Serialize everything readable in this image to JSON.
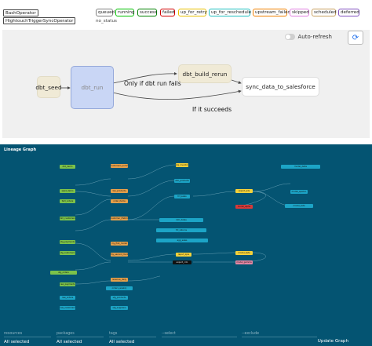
{
  "operators": [
    "BashOperator",
    "HightouchTriggerSyncOperator"
  ],
  "states": [
    {
      "label": "queued",
      "color": "#808080"
    },
    {
      "label": "running",
      "color": "#00c000"
    },
    {
      "label": "success",
      "color": "#008000"
    },
    {
      "label": "failed",
      "color": "#d00000"
    },
    {
      "label": "up_for_retry",
      "color": "#e8c000"
    },
    {
      "label": "up_for_reschedule",
      "color": "#20c0c0"
    },
    {
      "label": "upstream_failed",
      "color": "#f08000"
    },
    {
      "label": "skipped",
      "color": "#e080e0"
    },
    {
      "label": "scheduled",
      "color": "#c8a060"
    },
    {
      "label": "deferred",
      "color": "#8050c0"
    }
  ],
  "no_status": "no_status",
  "graph": {
    "auto_refresh_label": "Auto-refresh",
    "refresh_icon": "refresh-icon",
    "tasks": {
      "dbt_seed": "dbt_seed",
      "dbt_run": "dbt_run",
      "dbt_build_rerun": "dbt_build_rerun",
      "sync": "sync_data_to_salesforce"
    },
    "edge_labels": {
      "fail": "Only if dbt run fails",
      "succeed": "If it succeeds"
    },
    "colors": {
      "bash_fill": "#f0ead6",
      "sync_fill": "#ffffff",
      "selected_fill": "#c9d6f5"
    }
  },
  "lineage": {
    "title": "Lineage Graph",
    "nodes": {
      "n1": "dbt_demo",
      "n2": "seed_demo",
      "n3": "fact_orders",
      "n4": "dim_customers",
      "n5": "stg_payments",
      "n6": "stg_customers",
      "n7": "stg_orders",
      "n8": "raw_payments",
      "n9": "raw_orders",
      "n10": "raw_customers",
      "n11": "customers_summary",
      "n12": "top_products",
      "n13": "order_items",
      "n14": "customer_lifetime_value",
      "n15": "my_first_model",
      "n16": "my_second_model",
      "n17": "revenue_daily",
      "n18": "orders_weekly",
      "n19": "stg_products",
      "n20": "stg_suppliers",
      "n21": "stg_inventory",
      "n22": "dim_products",
      "n23": "fct_sales",
      "n24": "dim_dates",
      "n25": "fct_returns",
      "n26": "agg_sales",
      "n27": "report_kpis",
      "n28": "export_crm",
      "n29": "export_ads",
      "n30": "model_alpha",
      "n31": "model_beta",
      "n32": "model_gamma",
      "n33": "model_delta",
      "n34": "model_epsilon",
      "n35": "model_zeta",
      "n36": "model_eta",
      "n37": "model_theta",
      "n38": "model_iota",
      "n39": "model_kappa",
      "n40": "model_lambda",
      "n41": "model_mu",
      "n42": "model_nu",
      "n43": "model_xi",
      "n44": "model_omicron"
    }
  },
  "filters": {
    "resources_label": "resources",
    "resources_value": "All selected",
    "packages_label": "packages",
    "packages_value": "All selected",
    "tags_label": "tags",
    "tags_value": "All selected",
    "select_label": "--select",
    "exclude_label": "--exclude",
    "update_label": "Update Graph"
  }
}
